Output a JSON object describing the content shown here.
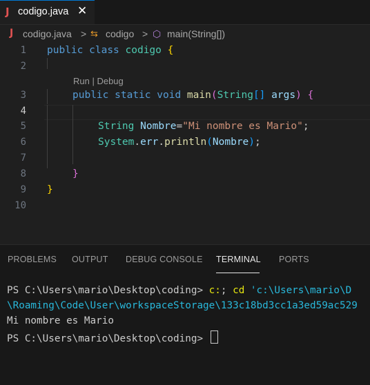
{
  "tab": {
    "icon": "J",
    "title": "codigo.java",
    "close": "✕"
  },
  "breadcrumb": {
    "icon": "J",
    "file": "codigo.java",
    "class_icon": "⇆",
    "class_name": "codigo",
    "method_icon": "⬡",
    "method_name": "main(String[])",
    "sep": ">"
  },
  "editor": {
    "line_numbers": [
      "1",
      "2",
      "3",
      "4",
      "5",
      "6",
      "7",
      "8",
      "9",
      "10"
    ],
    "codelens": "Run | Debug",
    "lines": {
      "l1": {
        "kw1": "public",
        "kw2": "class",
        "name": "codigo",
        "brace": "{"
      },
      "l3": {
        "kw1": "public",
        "kw2": "static",
        "kw3": "void",
        "fn": "main",
        "p1": "(",
        "type": "String",
        "arr": "[]",
        "arg": "args",
        "p2": ")",
        "brace": "{"
      },
      "l5": {
        "type": "String",
        "var": "Nombre",
        "eq": "=",
        "str": "\"Mi nombre es Mario\"",
        "semi": ";"
      },
      "l6": {
        "cls": "System",
        "d1": ".",
        "field": "err",
        "d2": ".",
        "fn": "println",
        "p1": "(",
        "arg": "Nombre",
        "p2": ")",
        "semi": ";"
      },
      "l8": {
        "brace": "}"
      },
      "l9": {
        "brace": "}"
      }
    }
  },
  "panel": {
    "tabs": [
      "PROBLEMS",
      "OUTPUT",
      "DEBUG CONSOLE",
      "TERMINAL",
      "PORTS"
    ],
    "active_tab": "TERMINAL",
    "terminal": {
      "prompt1": "PS C:\\Users\\mario\\Desktop\\coding> ",
      "cmd1a": "c:",
      "cmd1b": "; ",
      "cmd1c": "cd",
      "cmd1d": " 'c:\\Users\\mario\\D",
      "line2": "\\Roaming\\Code\\User\\workspaceStorage\\133c18bd3cc1a3ed59ac529",
      "line3": "Mi nombre es Mario",
      "prompt2": "PS C:\\Users\\mario\\Desktop\\coding> "
    }
  },
  "colors": {
    "background": "#1f1f1f",
    "accent": "#0078d4",
    "keyword": "#569cd6",
    "type": "#4ec9b0",
    "string": "#ce9178"
  }
}
